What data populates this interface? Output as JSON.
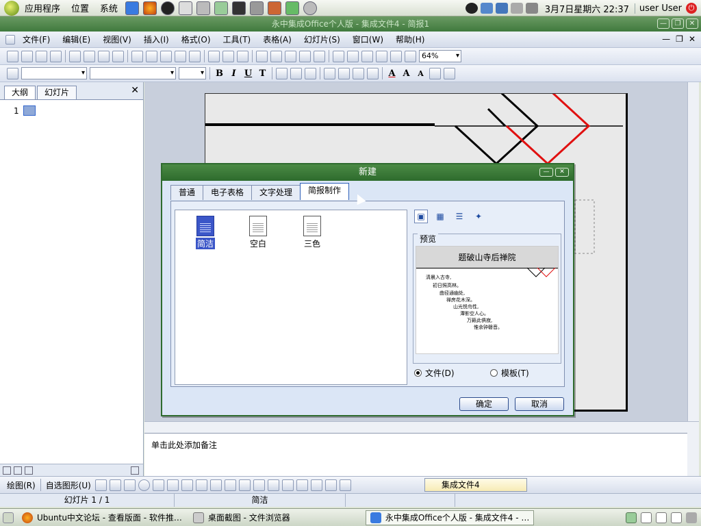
{
  "top_panel": {
    "menus": [
      "应用程序",
      "位置",
      "系统"
    ],
    "clock": "3月7日星期六 22:37",
    "user": "user User"
  },
  "app": {
    "title": "永中集成Office个人版 - 集成文件4 - 简报1",
    "menus": [
      "文件(F)",
      "编辑(E)",
      "视图(V)",
      "插入(I)",
      "格式(O)",
      "工具(T)",
      "表格(A)",
      "幻灯片(S)",
      "窗口(W)",
      "帮助(H)"
    ],
    "zoom": "64%"
  },
  "left_pane": {
    "tabs": [
      "大纲",
      "幻灯片"
    ],
    "slide_number": "1"
  },
  "notes_placeholder": "单击此处添加备注",
  "draw_toolbar": {
    "draw_label": "绘图(R)",
    "autoshape_label": "自选图形(U)",
    "task_label": "集成文件4"
  },
  "status": {
    "slide_info": "幻灯片 1 / 1",
    "template": "简洁"
  },
  "taskbar": {
    "items": [
      "Ubuntu中文论坛 - 查看版面 - 软件推…",
      "桌面截图 - 文件浏览器",
      "永中集成Office个人版 - 集成文件4 - …"
    ]
  },
  "dialog": {
    "title": "新建",
    "tabs": [
      "普通",
      "电子表格",
      "文字处理",
      "简报制作"
    ],
    "files": [
      "简洁",
      "空白",
      "三色"
    ],
    "preview_label": "预览",
    "preview": {
      "title": "题破山寺后禅院",
      "lines": [
        "清晨入古寺,",
        "初日照高林。",
        "曲径通幽处,",
        "禅房花木深。",
        "山光悦鸟性,",
        "潭影空人心。",
        "万籁此俱寂,",
        "惟余钟磬音。"
      ]
    },
    "radio_file": "文件(D)",
    "radio_template": "模板(T)",
    "ok_label": "确定",
    "cancel_label": "取消"
  },
  "colors": {
    "title_green": "#3f7a3d",
    "dialog_border": "#2e6b2e",
    "selection_blue": "#3b56c8",
    "slide_red": "#e01010"
  }
}
